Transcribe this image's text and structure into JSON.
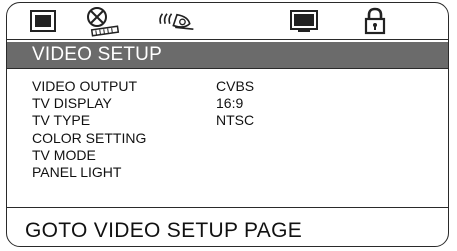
{
  "tabs": [
    {
      "icon": "monitor-icon",
      "active": false
    },
    {
      "icon": "speaker-disc-icon",
      "active": true
    },
    {
      "icon": "audio-waves-icon",
      "active": false
    },
    {
      "icon": "screen-icon",
      "active": false
    },
    {
      "icon": "lock-icon",
      "active": false
    }
  ],
  "title": "VIDEO SETUP",
  "menu": [
    {
      "label": "VIDEO OUTPUT",
      "value": "CVBS"
    },
    {
      "label": "TV DISPLAY",
      "value": "16:9"
    },
    {
      "label": "TV TYPE",
      "value": "NTSC"
    },
    {
      "label": "COLOR SETTING",
      "value": ""
    },
    {
      "label": "TV MODE",
      "value": ""
    },
    {
      "label": "PANEL LIGHT",
      "value": ""
    }
  ],
  "status": "GOTO VIDEO SETUP PAGE",
  "colors": {
    "title_bar": "#6b6b6b",
    "border": "#2a2a2a"
  }
}
